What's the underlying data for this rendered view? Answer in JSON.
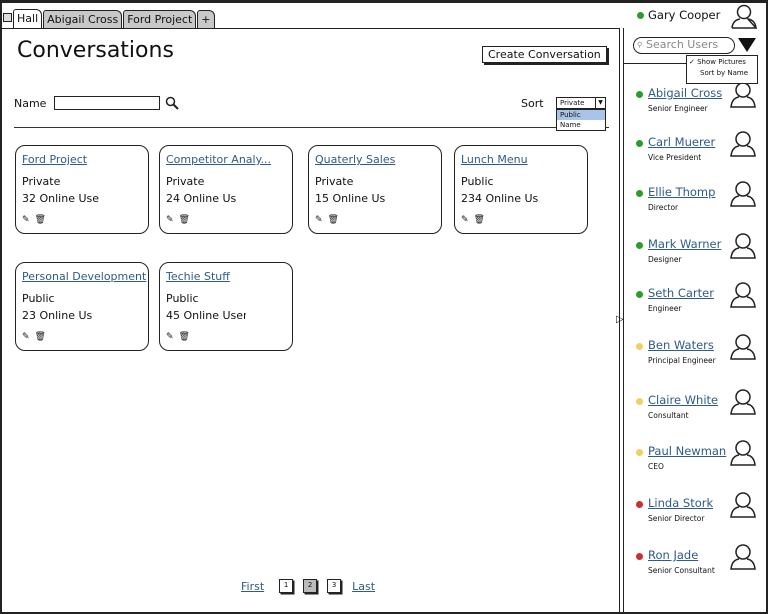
{
  "tabs": [
    {
      "label": "Hall"
    },
    {
      "label": "Abigail Cross"
    },
    {
      "label": "Ford Project"
    },
    {
      "label": "+"
    }
  ],
  "page_title": "Conversations",
  "create_button": "Create Conversation",
  "filter": {
    "name_label": "Name",
    "name_value": "",
    "sort_label": "Sort",
    "sort_selected": "Private",
    "sort_options": [
      "Public",
      "Name"
    ]
  },
  "cards": [
    {
      "title": "Ford Project",
      "visibility": "Private",
      "online": "32 Online Use"
    },
    {
      "title": "Competitor Analy...",
      "visibility": "Private",
      "online": "24 Online Us"
    },
    {
      "title": "Quaterly Sales",
      "visibility": "Private",
      "online": "15 Online Us"
    },
    {
      "title": "Lunch Menu",
      "visibility": "Public",
      "online": "234 Online Us"
    },
    {
      "title": "Personal Development",
      "visibility": "Public",
      "online": "23 Online Us"
    },
    {
      "title": "Techie Stuff",
      "visibility": "Public",
      "online": "45 Online User"
    }
  ],
  "pagination": {
    "first": "First",
    "pages": [
      "1",
      "2",
      "3"
    ],
    "current": "2",
    "last": "Last"
  },
  "current_user": {
    "name": "Gary Cooper",
    "status_color": "#2a9d2a"
  },
  "search": {
    "placeholder": "Search Users"
  },
  "user_menu": {
    "show_pictures": "Show Pictures",
    "show_pictures_checked": true,
    "sort_by_name": "Sort by Name"
  },
  "users": [
    {
      "name": "Abigail Cross",
      "role": "Senior Engineer",
      "status_color": "#2a9d2a"
    },
    {
      "name": "Carl Muerer",
      "role": "Vice President",
      "status_color": "#2a9d2a"
    },
    {
      "name": "Ellie Thomp",
      "role": "Director",
      "status_color": "#2a9d2a"
    },
    {
      "name": "Mark Warner",
      "role": "Designer",
      "status_color": "#2a9d2a"
    },
    {
      "name": "Seth Carter",
      "role": "Engineer",
      "status_color": "#2a9d2a"
    },
    {
      "name": "Ben Waters",
      "role": "Principal Engineer",
      "status_color": "#f0d060"
    },
    {
      "name": "Claire White",
      "role": "Consultant",
      "status_color": "#f0d060"
    },
    {
      "name": "Paul Newman",
      "role": "CEO",
      "status_color": "#f0d060"
    },
    {
      "name": "Linda Stork",
      "role": "Senior Director",
      "status_color": "#c83030"
    },
    {
      "name": "Ron Jade",
      "role": "Senior Consultant",
      "status_color": "#c83030"
    }
  ]
}
